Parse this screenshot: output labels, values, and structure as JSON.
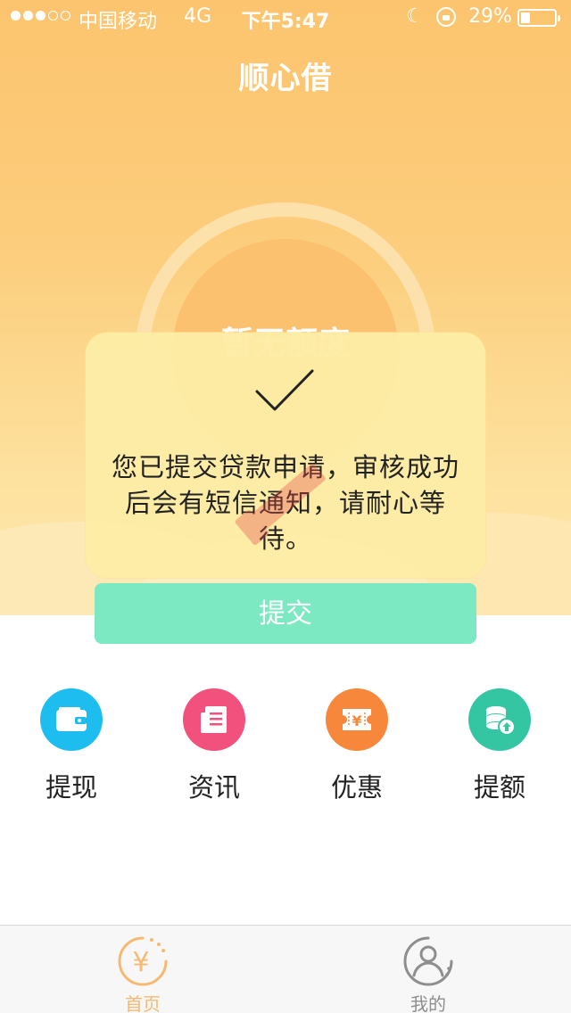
{
  "status_bar": {
    "carrier": "中国移动",
    "network": "4G",
    "time": "下午5:47",
    "battery": "29%",
    "battery_level": 0.29,
    "signal_bars_filled": 3,
    "signal_bars_total": 5
  },
  "header": {
    "title": "顺心借"
  },
  "limit_card": {
    "label": "暂无额度"
  },
  "toast": {
    "icon": "checkmark-icon",
    "message": "您已提交贷款申请，审核成功后会有短信通知，请耐心等待。"
  },
  "submit": {
    "label": "提交",
    "color": "#7ce9c3"
  },
  "quick_menu": [
    {
      "label": "提现",
      "icon": "wallet-icon",
      "color": "#1ebdf0"
    },
    {
      "label": "资讯",
      "icon": "news-icon",
      "color": "#f2517e"
    },
    {
      "label": "优惠",
      "icon": "coupon-icon",
      "color": "#f7873a"
    },
    {
      "label": "提额",
      "icon": "coins-up-icon",
      "color": "#34c5a2"
    }
  ],
  "tab_bar": [
    {
      "label": "首页",
      "icon": "yuan-icon",
      "active": true,
      "color": "#f5b971"
    },
    {
      "label": "我的",
      "icon": "user-icon",
      "active": false,
      "color": "#8e8e8e"
    }
  ]
}
